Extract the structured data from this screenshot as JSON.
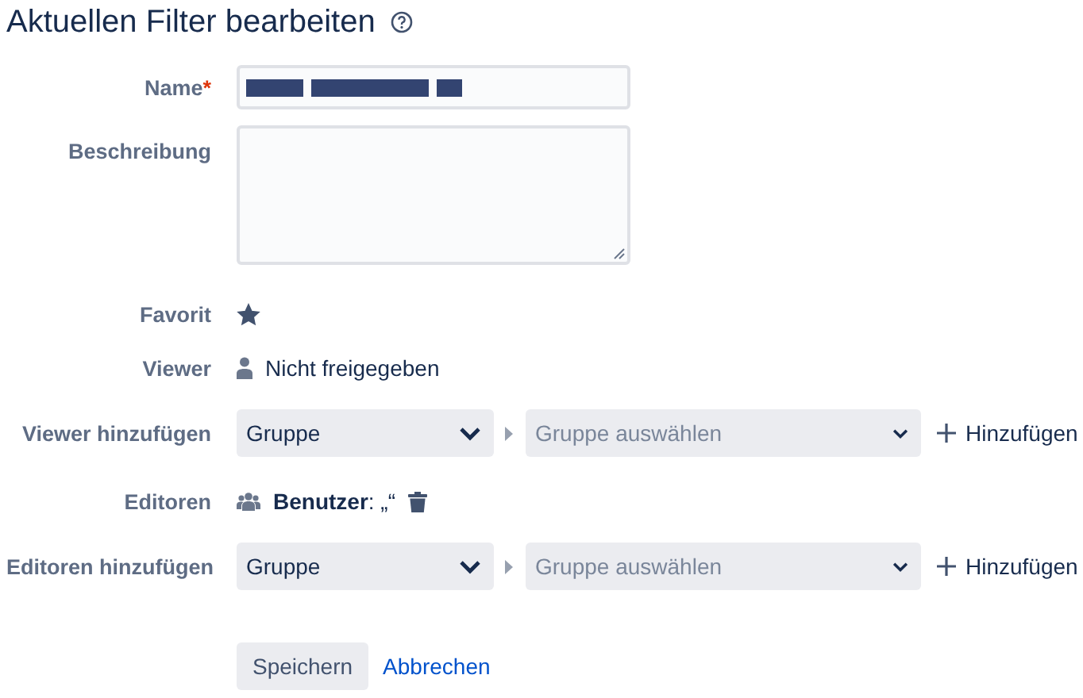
{
  "title": "Aktuellen Filter bearbeiten",
  "fields": [
    {
      "kind": "text",
      "label": "Name",
      "required_mark": "*",
      "redacted": true
    },
    {
      "kind": "textarea",
      "label": "Beschreibung"
    },
    {
      "kind": "star",
      "label": "Favorit",
      "favorite": true
    },
    {
      "kind": "viewers",
      "label": "Viewer",
      "text": "Nicht freigegeben"
    },
    {
      "kind": "add",
      "label": "Viewer hinzufügen",
      "type": "Gruppe",
      "placeholder": "Gruppe auswählen",
      "action": "Hinzufügen"
    },
    {
      "kind": "editors",
      "label": "Editoren",
      "text": "**Benutzer**: „“",
      "deletable": true
    },
    {
      "kind": "add",
      "label": "Editoren hinzufügen",
      "type": "Gruppe",
      "placeholder": "Gruppe auswählen",
      "action": "Hinzufügen"
    }
  ],
  "buttons": {
    "save": "Speichern",
    "cancel": "Abbrechen"
  }
}
